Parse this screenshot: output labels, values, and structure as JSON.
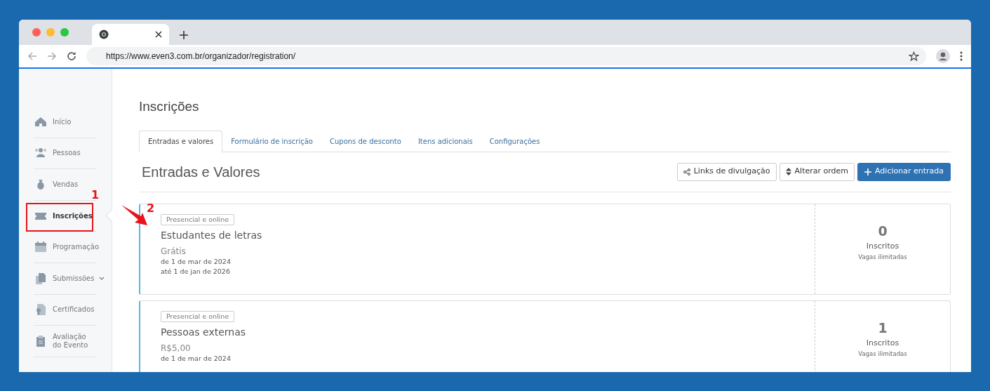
{
  "browser": {
    "url": "https://www.even3.com.br/organizador/registration/"
  },
  "sidebar": {
    "items": [
      {
        "label": "Início",
        "kind": "home",
        "selected": false,
        "expandable": false
      },
      {
        "label": "Pessoas",
        "kind": "people",
        "selected": false,
        "expandable": false
      },
      {
        "label": "Vendas",
        "kind": "moneybag",
        "selected": false,
        "expandable": false
      },
      {
        "label": "Inscrições",
        "kind": "ticket",
        "selected": true,
        "expandable": false
      },
      {
        "label": "Programação",
        "kind": "calendar",
        "selected": false,
        "expandable": false
      },
      {
        "label": "Submissões",
        "kind": "documents",
        "selected": false,
        "expandable": true
      },
      {
        "label": "Certificados",
        "kind": "certificate",
        "selected": false,
        "expandable": false
      },
      {
        "label": "Avaliação do Evento",
        "kind": "clipboard",
        "selected": false,
        "expandable": false
      }
    ]
  },
  "annotations": [
    {
      "label": "1"
    },
    {
      "label": "2"
    }
  ],
  "page": {
    "title": "Inscrições",
    "tabs": [
      {
        "label": "Entradas e valores",
        "selected": true
      },
      {
        "label": "Formulário de inscrição",
        "selected": false
      },
      {
        "label": "Cupons de desconto",
        "selected": false
      },
      {
        "label": "Itens adicionais",
        "selected": false
      },
      {
        "label": "Configurações",
        "selected": false
      }
    ],
    "section_title": "Entradas e Valores",
    "buttons": [
      {
        "label": "Links de divulgação",
        "kind": "share"
      },
      {
        "label": "Alterar ordem",
        "kind": "sort"
      },
      {
        "label": "Adicionar entrada",
        "kind": "add"
      }
    ],
    "tickets": [
      {
        "mode": "Presencial e online",
        "name": "Estudantes de letras",
        "price": "Grátis",
        "dates": [
          "de 1 de mar de 2024",
          "até 1 de jan de 2026"
        ],
        "count": "0",
        "count_label": "Inscritos",
        "capacity": "Vagas ilimitadas"
      },
      {
        "mode": "Presencial e online",
        "name": "Pessoas externas",
        "price": "R$5,00",
        "dates": [
          "de 1 de mar de 2024"
        ],
        "count": "1",
        "count_label": "Inscritos",
        "capacity": "Vagas ilimitadas"
      }
    ]
  }
}
